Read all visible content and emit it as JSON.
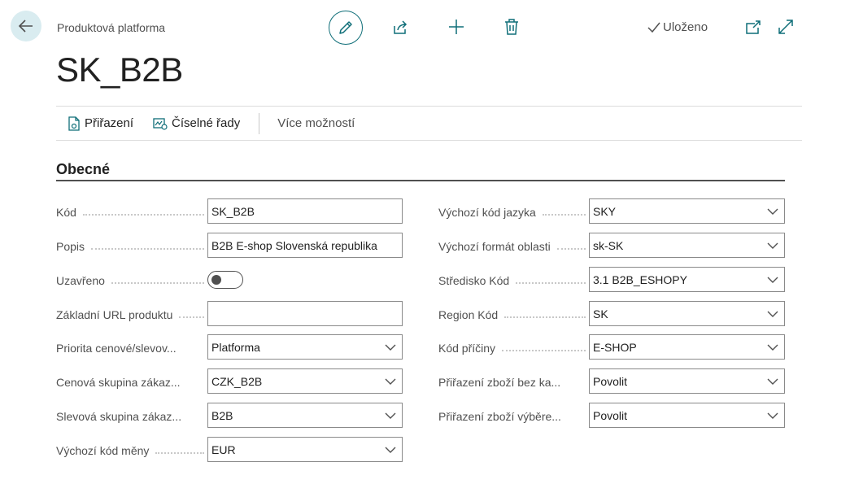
{
  "header": {
    "breadcrumb": "Produktová platforma",
    "saved_status": "Uloženo",
    "title": "SK_B2B"
  },
  "action_bar": {
    "items": [
      {
        "label": "Přiřazení",
        "icon": "assignment-doc-icon"
      },
      {
        "label": "Číselné řady",
        "icon": "number-series-icon"
      }
    ],
    "more_options": "Více možností"
  },
  "section": {
    "title": "Obecné"
  },
  "left_fields": [
    {
      "label": "Kód",
      "value": "SK_B2B",
      "type": "text"
    },
    {
      "label": "Popis",
      "value": "B2B E-shop Slovenská republika",
      "type": "text"
    },
    {
      "label": "Uzavřeno",
      "value": "",
      "type": "toggle",
      "checked": false
    },
    {
      "label": "Základní URL produktu",
      "value": "",
      "type": "text"
    },
    {
      "label": "Priorita cenové/slevov...",
      "value": "Platforma",
      "type": "select"
    },
    {
      "label": "Cenová skupina zákaz...",
      "value": "CZK_B2B",
      "type": "select"
    },
    {
      "label": "Slevová skupina zákaz...",
      "value": "B2B",
      "type": "select"
    },
    {
      "label": "Výchozí kód měny",
      "value": "EUR",
      "type": "select"
    }
  ],
  "right_fields": [
    {
      "label": "Výchozí kód jazyka",
      "value": "SKY",
      "type": "select"
    },
    {
      "label": "Výchozí formát oblasti",
      "value": "sk-SK",
      "type": "select"
    },
    {
      "label": "Středisko Kód",
      "value": "3.1 B2B_ESHOPY",
      "type": "select"
    },
    {
      "label": "Region Kód",
      "value": "SK",
      "type": "select"
    },
    {
      "label": "Kód příčiny",
      "value": "E-SHOP",
      "type": "select"
    },
    {
      "label": "Přiřazení zboží bez ka...",
      "value": "Povolit",
      "type": "select"
    },
    {
      "label": "Přiřazení zboží výběre...",
      "value": "Povolit",
      "type": "select"
    }
  ],
  "colors": {
    "accent": "#0f6e78",
    "back_button_bg": "#d9ecf0",
    "text_primary": "#212121",
    "text_secondary": "#505050"
  }
}
